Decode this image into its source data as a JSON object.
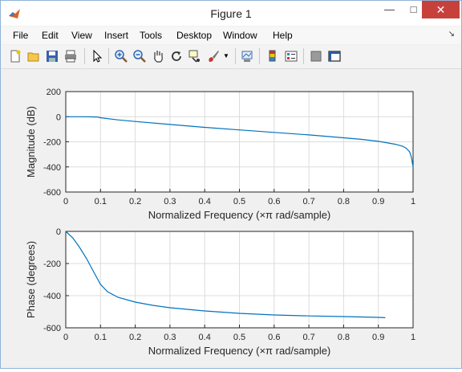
{
  "window": {
    "title": "Figure 1"
  },
  "menu": [
    "File",
    "Edit",
    "View",
    "Insert",
    "Tools",
    "Desktop",
    "Window",
    "Help"
  ],
  "toolbar_icons": [
    "new-figure-icon",
    "open-file-icon",
    "save-icon",
    "print-icon",
    "pointer-icon",
    "zoom-in-icon",
    "zoom-out-icon",
    "pan-icon",
    "rotate-icon",
    "data-cursor-icon",
    "brush-icon",
    "link-plot-icon",
    "colorbar-icon",
    "legend-icon",
    "hide-tools-icon",
    "show-tools-icon"
  ],
  "chart_data": [
    {
      "type": "line",
      "xlabel": "Normalized Frequency  (×π rad/sample)",
      "ylabel": "Magnitude (dB)",
      "xlim": [
        0,
        1
      ],
      "ylim": [
        -600,
        200
      ],
      "xticks": [
        "0",
        "0.1",
        "0.2",
        "0.3",
        "0.4",
        "0.5",
        "0.6",
        "0.7",
        "0.8",
        "0.9",
        "1"
      ],
      "yticks": [
        "200",
        "0",
        "-200",
        "-400",
        "-600"
      ],
      "grid": true,
      "x": [
        0,
        0.05,
        0.09,
        0.1,
        0.15,
        0.2,
        0.3,
        0.4,
        0.5,
        0.6,
        0.7,
        0.8,
        0.85,
        0.9,
        0.95,
        0.97,
        0.98,
        0.99,
        0.995,
        1.0
      ],
      "y": [
        0,
        0,
        -2,
        -8,
        -25,
        -38,
        -62,
        -85,
        -105,
        -125,
        -145,
        -168,
        -180,
        -196,
        -220,
        -235,
        -250,
        -280,
        -320,
        -400
      ]
    },
    {
      "type": "line",
      "xlabel": "Normalized Frequency  (×π rad/sample)",
      "ylabel": "Phase (degrees)",
      "xlim": [
        0,
        1
      ],
      "ylim": [
        -600,
        0
      ],
      "xticks": [
        "0",
        "0.1",
        "0.2",
        "0.3",
        "0.4",
        "0.5",
        "0.6",
        "0.7",
        "0.8",
        "0.9",
        "1"
      ],
      "yticks": [
        "0",
        "-200",
        "-400",
        "-600"
      ],
      "grid": true,
      "x": [
        0,
        0.02,
        0.04,
        0.06,
        0.08,
        0.1,
        0.12,
        0.15,
        0.2,
        0.25,
        0.3,
        0.4,
        0.5,
        0.6,
        0.7,
        0.8,
        0.9,
        0.92
      ],
      "y": [
        0,
        -40,
        -100,
        -170,
        -250,
        -330,
        -375,
        -410,
        -440,
        -460,
        -475,
        -495,
        -510,
        -520,
        -526,
        -530,
        -535,
        -537
      ]
    }
  ]
}
